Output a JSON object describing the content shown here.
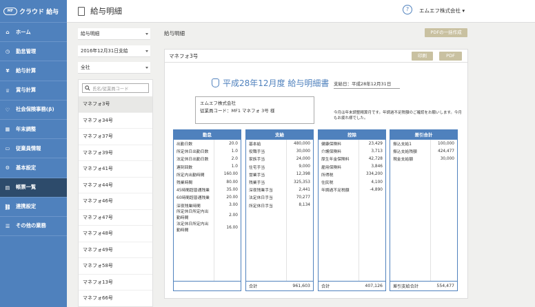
{
  "app": {
    "logo_text": "クラウド 給与",
    "logo_mark": "MF"
  },
  "nav": [
    {
      "label": "ホーム",
      "icon": "home-icon"
    },
    {
      "label": "勤怠管理",
      "icon": "clock-icon"
    },
    {
      "label": "給与計算",
      "icon": "yen-icon"
    },
    {
      "label": "賞与計算",
      "icon": "trophy-icon"
    },
    {
      "label": "社会保険事務(β)",
      "icon": "heart-icon"
    },
    {
      "label": "年末調整",
      "icon": "calculator-icon"
    },
    {
      "label": "従業員情報",
      "icon": "id-card-icon"
    },
    {
      "label": "基本設定",
      "icon": "gear-icon"
    },
    {
      "label": "帳票一覧",
      "icon": "document-icon",
      "active": true
    },
    {
      "label": "連携設定",
      "icon": "link-icon"
    },
    {
      "label": "その他の業務",
      "icon": "list-icon"
    }
  ],
  "header": {
    "title": "給与明細",
    "help": "?",
    "company": "エムエフ株式会社"
  },
  "filters": {
    "doc_type": "給与明細",
    "pay_date": "2016年12月31日支給",
    "scope": "全社",
    "search_placeholder": "氏名/従業員コード"
  },
  "employees": [
    "マネフォ3号",
    "マネフォ34号",
    "マネフォ37号",
    "マネフォ39号",
    "マネフォ41号",
    "マネフォ44号",
    "マネフォ46号",
    "マネフォ47号",
    "マネフォ48号",
    "マネフォ49号",
    "マネフォ58号",
    "マネフォ13号",
    "マネフォ66号"
  ],
  "section_title": "給与明細",
  "bulk_pdf_label": "PDFの一括作成",
  "card": {
    "name": "マネフォ3号",
    "print_label": "印刷",
    "pdf_label": "PDF",
    "slip_title": "平成28年12月度 給与明細書",
    "pay_date_text": "支給日：平成28年12月31日",
    "company": "エムエフ株式会社",
    "employee_line": "従業員コード：MF1     マネフォ 3号 様",
    "note": "今月は年末調整精算月です。年調過不足税額のご確認をお願いします。今月もお疲れ様でした。"
  },
  "columns": [
    {
      "title": "勤怠",
      "rows": [
        [
          "出勤日数",
          "20.0"
        ],
        [
          "所定休日出勤日数",
          "1.0"
        ],
        [
          "法定休日出勤日数",
          "2.0"
        ],
        [
          "遅刻回数",
          "1.0"
        ],
        [
          "所定内出勤時間",
          "160.00"
        ],
        [
          "残業時間",
          "80.00"
        ],
        [
          "45時間超普通残業",
          "35.00"
        ],
        [
          "60時間超普通残業",
          "20.00"
        ],
        [
          "深夜残業時間",
          "3.00"
        ],
        [
          "所定休日所定内出勤時間",
          "2.00"
        ],
        [
          "法定休日所定内出勤時間",
          "16.00"
        ]
      ],
      "total_label": "",
      "total": ""
    },
    {
      "title": "支給",
      "rows": [
        [
          "基本給",
          "480,000"
        ],
        [
          "役職手当",
          "30,000"
        ],
        [
          "家族手当",
          "24,000"
        ],
        [
          "住宅手当",
          "9,000"
        ],
        [
          "営業手当",
          "12,398"
        ],
        [
          "残業手当",
          "325,353"
        ],
        [
          "深夜残業手当",
          "2,441"
        ],
        [
          "法定休日手当",
          "70,277"
        ],
        [
          "所定休日手当",
          "8,134"
        ]
      ],
      "total_label": "合計",
      "total": "961,603"
    },
    {
      "title": "控除",
      "rows": [
        [
          "健康保険料",
          "23,429"
        ],
        [
          "介護保険料",
          "3,713"
        ],
        [
          "厚生年金保険料",
          "42,728"
        ],
        [
          "雇用保険料",
          "3,846"
        ],
        [
          "所得税",
          "334,200"
        ],
        [
          "住民税",
          "4,100"
        ],
        [
          "年調過不足税額",
          "-4,890"
        ]
      ],
      "total_label": "合計",
      "total": "407,126"
    },
    {
      "title": "差引合計",
      "rows": [
        [
          "振込支給1",
          "100,000"
        ],
        [
          "振込支給残額",
          "424,477"
        ],
        [
          "現金支給額",
          "30,000"
        ]
      ],
      "total_label": "差引支給合計",
      "total": "554,477"
    }
  ]
}
